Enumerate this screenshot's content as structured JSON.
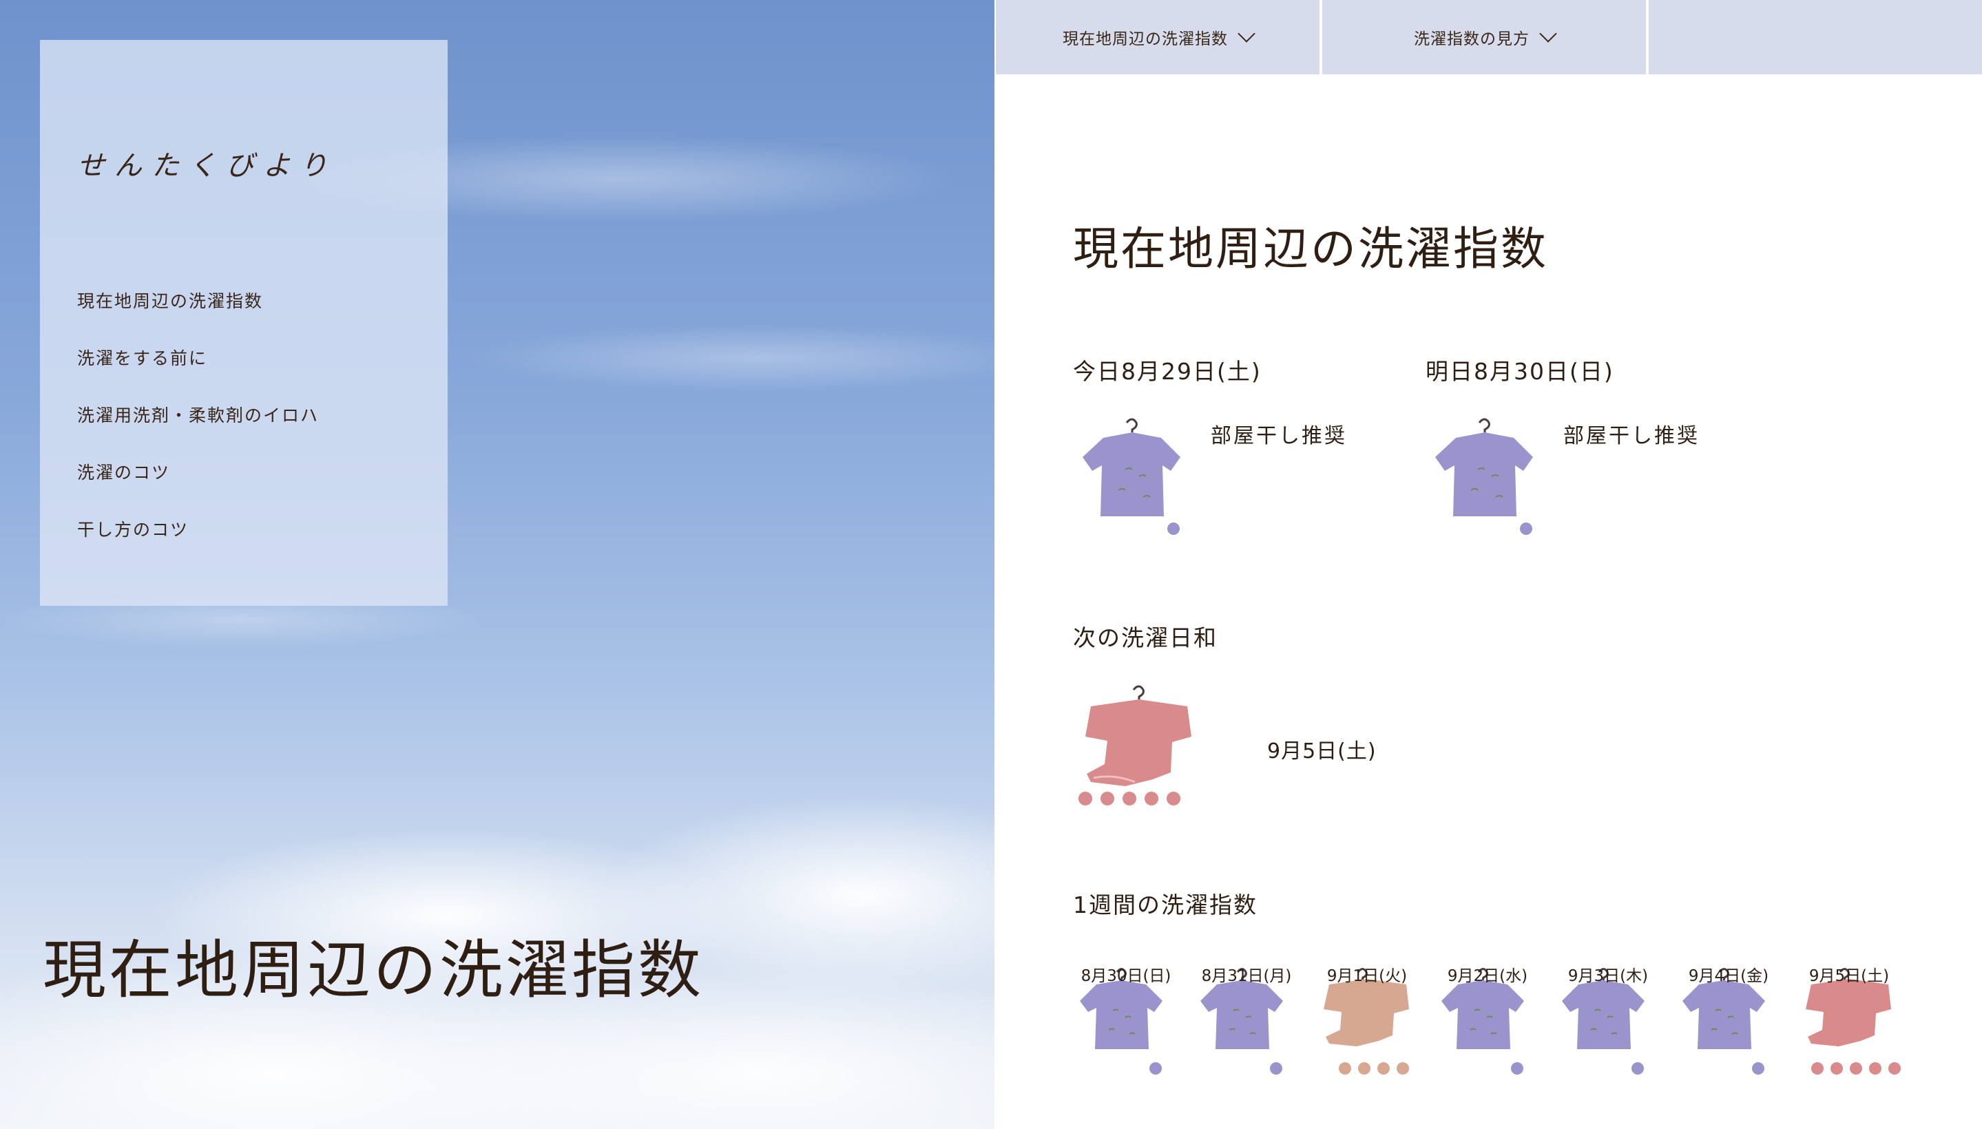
{
  "sidebar": {
    "logo": "せんたくびより",
    "items": [
      {
        "label": "現在地周辺の洗濯指数"
      },
      {
        "label": "洗濯をする前に"
      },
      {
        "label": "洗濯用洗剤・柔軟剤のイロハ"
      },
      {
        "label": "洗濯のコツ"
      },
      {
        "label": "干し方のコツ"
      }
    ]
  },
  "hero": {
    "title": "現在地周辺の洗濯指数"
  },
  "topnav": {
    "tabs": [
      {
        "label": "現在地周辺の洗濯指数"
      },
      {
        "label": "洗濯指数の見方"
      },
      {
        "label": ""
      }
    ]
  },
  "main": {
    "heading": "現在地周辺の洗濯指数",
    "today": {
      "label": "今日8月29日(土)",
      "status": "部屋干し推奨",
      "level": 1
    },
    "tomorrow": {
      "label": "明日8月30日(日)",
      "status": "部屋干し推奨",
      "level": 1
    },
    "next_good_day": {
      "heading": "次の洗濯日和",
      "date": "9月5日(土)",
      "level": 5
    },
    "week": {
      "heading": "1週間の洗濯指数",
      "days": [
        {
          "date": "8月30日(日)",
          "level": 1
        },
        {
          "date": "8月31日(月)",
          "level": 1
        },
        {
          "date": "9月1日(火)",
          "level": 4
        },
        {
          "date": "9月2日(水)",
          "level": 1
        },
        {
          "date": "9月3日(木)",
          "level": 1
        },
        {
          "date": "9月4日(金)",
          "level": 1
        },
        {
          "date": "9月5日(土)",
          "level": 5
        }
      ]
    }
  },
  "colors": {
    "low": "#9a93cc",
    "mid": "#d6a891",
    "high": "#d98a8a",
    "tab_bg": "#d6dcec",
    "text": "#2f1e12"
  }
}
